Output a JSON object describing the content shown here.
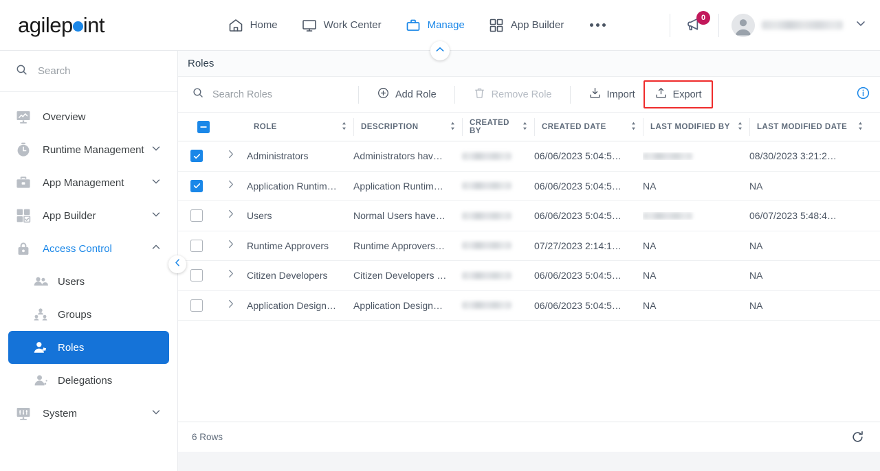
{
  "brand": {
    "name_before": "agilep",
    "name_after": "int",
    "dot_color": "#1a87e8"
  },
  "topnav": {
    "items": [
      {
        "label": "Home",
        "icon": "home-icon",
        "active": false
      },
      {
        "label": "Work Center",
        "icon": "monitor-icon",
        "active": false
      },
      {
        "label": "Manage",
        "icon": "briefcase-icon",
        "active": true
      },
      {
        "label": "App Builder",
        "icon": "grid-icon",
        "active": false
      }
    ],
    "more_label": "",
    "notification_count": "0",
    "user_name": ""
  },
  "sidebar": {
    "search_placeholder": "Search",
    "items": [
      {
        "label": "Overview",
        "icon": "monitor-chart-icon",
        "chevron": "none"
      },
      {
        "label": "Runtime Management",
        "icon": "stopwatch-icon",
        "chevron": "down"
      },
      {
        "label": "App Management",
        "icon": "toolbox-icon",
        "chevron": "down"
      },
      {
        "label": "App Builder",
        "icon": "grid-check-icon",
        "chevron": "down"
      },
      {
        "label": "Access Control",
        "icon": "lock-icon",
        "chevron": "up",
        "expanded": true
      }
    ],
    "subitems": [
      {
        "label": "Users",
        "icon": "users-icon",
        "active": false
      },
      {
        "label": "Groups",
        "icon": "group-icon",
        "active": false
      },
      {
        "label": "Roles",
        "icon": "role-user-icon",
        "active": true
      },
      {
        "label": "Delegations",
        "icon": "delegation-icon",
        "active": false
      }
    ],
    "items_after": [
      {
        "label": "System",
        "icon": "system-icon",
        "chevron": "down"
      }
    ]
  },
  "panel": {
    "title": "Roles"
  },
  "toolbar": {
    "search_placeholder": "Search Roles",
    "add_label": "Add Role",
    "remove_label": "Remove Role",
    "import_label": "Import",
    "export_label": "Export",
    "highlight_color": "#ef2b2b"
  },
  "table": {
    "columns": [
      {
        "key": "role",
        "label": "ROLE"
      },
      {
        "key": "description",
        "label": "DESCRIPTION"
      },
      {
        "key": "created_by",
        "label": "CREATED BY"
      },
      {
        "key": "created_date",
        "label": "CREATED DATE"
      },
      {
        "key": "last_modified_by",
        "label": "LAST MODIFIED BY"
      },
      {
        "key": "last_modified_date",
        "label": "LAST MODIFIED DATE"
      }
    ],
    "select_all_state": "indeterminate",
    "rows": [
      {
        "checked": true,
        "role": "Administrators",
        "description": "Administrators hav…",
        "created_by": "",
        "created_by_blurred": true,
        "created_date": "06/06/2023 5:04:5…",
        "last_modified_by": "",
        "last_modified_by_blurred": true,
        "last_modified_date": "08/30/2023 3:21:2…"
      },
      {
        "checked": true,
        "role": "Application Runtim…",
        "description": "Application Runtim…",
        "created_by": "",
        "created_by_blurred": true,
        "created_date": "06/06/2023 5:04:5…",
        "last_modified_by": "NA",
        "last_modified_by_blurred": false,
        "last_modified_date": "NA"
      },
      {
        "checked": false,
        "role": "Users",
        "description": "Normal Users have…",
        "created_by": "",
        "created_by_blurred": true,
        "created_date": "06/06/2023 5:04:5…",
        "last_modified_by": "",
        "last_modified_by_blurred": true,
        "last_modified_date": "06/07/2023 5:48:4…"
      },
      {
        "checked": false,
        "role": "Runtime Approvers",
        "description": "Runtime Approvers…",
        "created_by": "",
        "created_by_blurred": true,
        "created_date": "07/27/2023 2:14:1…",
        "last_modified_by": "NA",
        "last_modified_by_blurred": false,
        "last_modified_date": "NA"
      },
      {
        "checked": false,
        "role": "Citizen Developers",
        "description": "Citizen Developers …",
        "created_by": "",
        "created_by_blurred": true,
        "created_date": "06/06/2023 5:04:5…",
        "last_modified_by": "NA",
        "last_modified_by_blurred": false,
        "last_modified_date": "NA"
      },
      {
        "checked": false,
        "role": "Application Design…",
        "description": "Application Design…",
        "created_by": "",
        "created_by_blurred": true,
        "created_date": "06/06/2023 5:04:5…",
        "last_modified_by": "NA",
        "last_modified_by_blurred": false,
        "last_modified_date": "NA"
      }
    ],
    "footer_rows_label": "6 Rows"
  }
}
